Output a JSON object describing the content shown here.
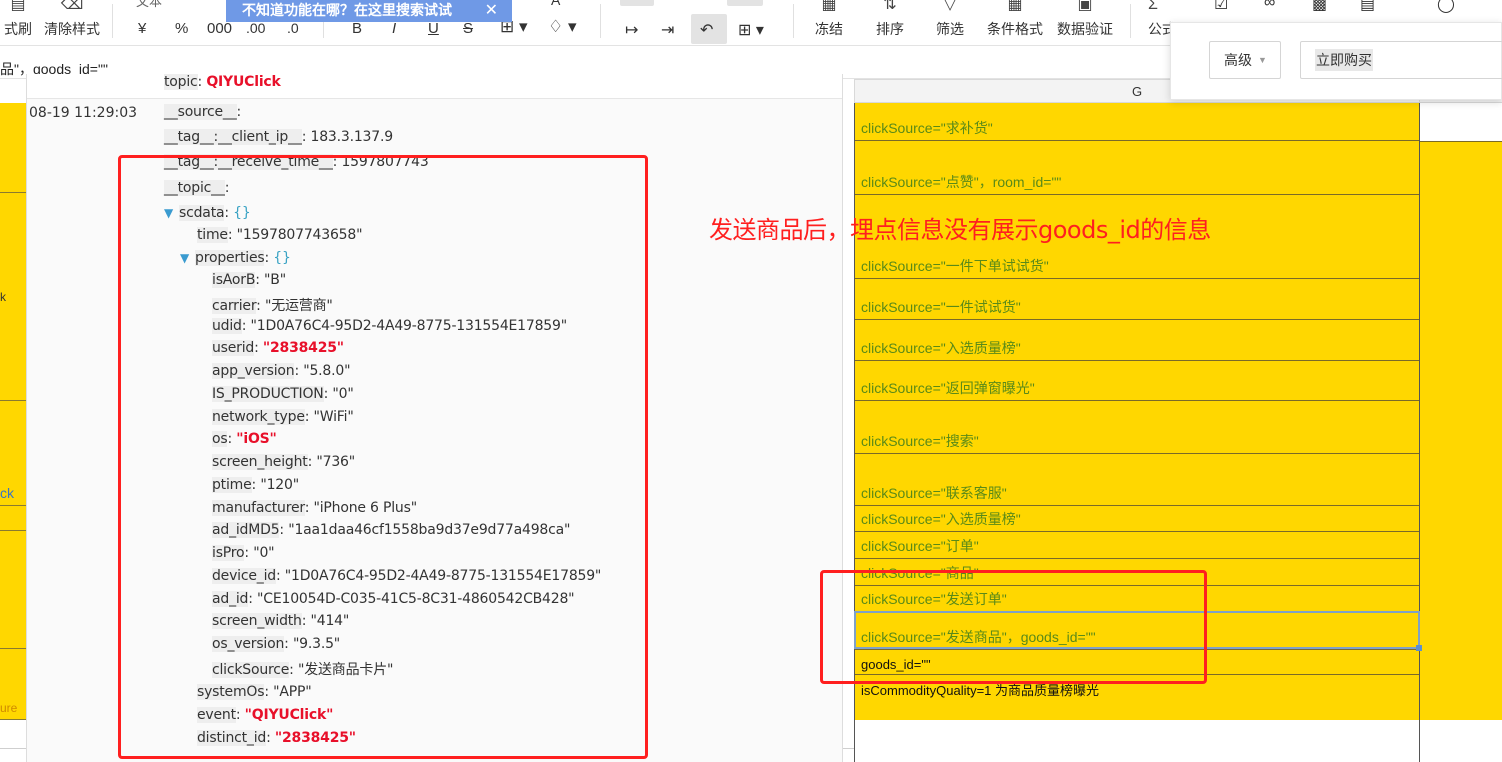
{
  "toolbar": {
    "format_painter_label": "式刷",
    "clear_format_label": "清除样式",
    "text_label": "文本",
    "currency_symbol": "¥",
    "percent_symbol": "%",
    "thousands_symbol": "000",
    "inc_decimal_symbol": ".00",
    "dec_decimal_symbol": ".0",
    "bold_symbol": "B",
    "italic_symbol": "I",
    "underline_symbol": "U",
    "strike_symbol": "S",
    "freeze_label": "冻结",
    "sort_label": "排序",
    "filter_label": "筛选",
    "cond_format_label": "条件格式",
    "data_validation_label": "数据验证",
    "formula_label": "公式",
    "tip_banner": "不知道功能在哪？在这里搜索试试"
  },
  "formula_bar": {
    "content": "品\"，goods_id=\"\""
  },
  "sheet": {
    "column_g_header": "G",
    "g_cells": [
      "clickSource=\"求补货\"",
      "clickSource=\"点赞\"，room_id=\"\"",
      "clickSource=\"一件下单试试货\"",
      "clickSource=\"一件试试货\"",
      "clickSource=\"入选质量榜\"",
      "clickSource=\"返回弹窗曝光\"",
      "clickSource=\"搜索\"",
      "clickSource=\"联系客服\"",
      "clickSource=\"入选质量榜\"",
      "clickSource=\"订单\"",
      "clickSource=\"商品\"",
      "clickSource=\"发送订单\"",
      "clickSource=\"发送商品\"，goods_id=\"\"",
      "goods_id=\"\"",
      "isCommodityQuality=1 为商品质量榜曝光"
    ],
    "left_fragments": {
      "a": "k",
      "b": "ck",
      "c": "ure"
    }
  },
  "log": {
    "timestamp": "08-19 11:29:03",
    "topic_key": "topic",
    "topic_value": "QIYUClick",
    "source_key": "__source__",
    "client_ip_key": "__tag__:__client_ip__",
    "client_ip_value": "183.3.137.9",
    "receive_time_key": "__tag__:__receive_time__",
    "receive_time_value": "1597807743",
    "topic2_key": "__topic__",
    "scdata_key": "scdata",
    "obj_symbol": "{}",
    "time_key": "time",
    "time_value": "\"1597807743658\"",
    "properties_key": "properties",
    "properties": [
      {
        "k": "isAorB",
        "v": "\"B\"",
        "red": false
      },
      {
        "k": "carrier",
        "v": "\"无运营商\"",
        "red": false
      },
      {
        "k": "udid",
        "v": "\"1D0A76C4-95D2-4A49-8775-131554E17859\"",
        "red": false
      },
      {
        "k": "userid",
        "v": "\"2838425\"",
        "red": true
      },
      {
        "k": "app_version",
        "v": "\"5.8.0\"",
        "red": false
      },
      {
        "k": "IS_PRODUCTION",
        "v": "\"0\"",
        "red": false
      },
      {
        "k": "network_type",
        "v": "\"WiFi\"",
        "red": false
      },
      {
        "k": "os",
        "v": "\"iOS\"",
        "red": true
      },
      {
        "k": "screen_height",
        "v": "\"736\"",
        "red": false
      },
      {
        "k": "ptime",
        "v": "\"120\"",
        "red": false
      },
      {
        "k": "manufacturer",
        "v": "\"iPhone 6 Plus\"",
        "red": false
      },
      {
        "k": "ad_idMD5",
        "v": "\"1aa1daa46cf1558ba9d37e9d77a498ca\"",
        "red": false
      },
      {
        "k": "isPro",
        "v": "\"0\"",
        "red": false
      },
      {
        "k": "device_id",
        "v": "\"1D0A76C4-95D2-4A49-8775-131554E17859\"",
        "red": false
      },
      {
        "k": "ad_id",
        "v": "\"CE10054D-C035-41C5-8C31-4860542CB428\"",
        "red": false
      },
      {
        "k": "screen_width",
        "v": "\"414\"",
        "red": false
      },
      {
        "k": "os_version",
        "v": "\"9.3.5\"",
        "red": false
      },
      {
        "k": "clickSource",
        "v": "\"发送商品卡片\"",
        "red": false
      }
    ],
    "systemOs_key": "systemOs",
    "systemOs_value": "\"APP\"",
    "event_key": "event",
    "event_value": "\"QIYUClick\"",
    "distinct_id_key": "distinct_id",
    "distinct_id_value": "\"2838425\""
  },
  "annotation": {
    "text": "发送商品后，埋点信息没有展示goods_id的信息"
  },
  "filter_popup": {
    "mode_label": "高级",
    "query_value": "立即购买"
  },
  "colors": {
    "sheet_yellow": "#ffd700",
    "annotation_red": "#ff1f1f",
    "value_red": "#e8102a",
    "tip_blue": "#6f99e6"
  }
}
